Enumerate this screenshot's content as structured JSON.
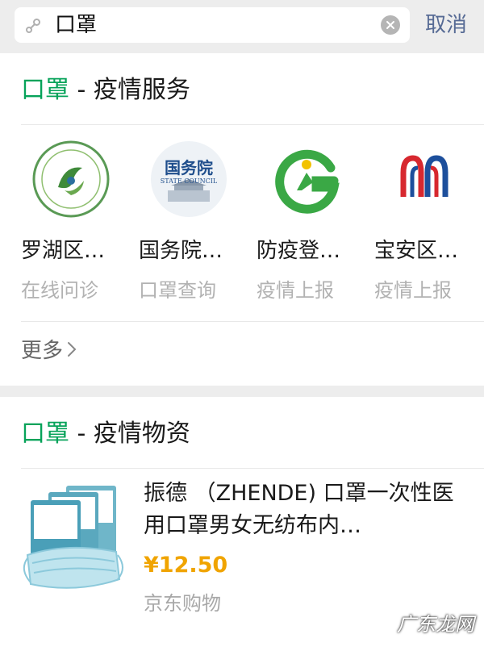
{
  "search": {
    "query": "口罩",
    "cancel_label": "取消"
  },
  "services_section": {
    "keyword": "口罩",
    "separator": " - ",
    "title": "疫情服务",
    "items": [
      {
        "name": "罗湖区…",
        "desc": "在线问诊",
        "logo": "luohu-health-logo"
      },
      {
        "name": "国务院…",
        "desc": "口罩查询",
        "logo": "state-council-logo",
        "logo_text": "国务院",
        "logo_subtext": "STATE COUNCIL"
      },
      {
        "name": "防疫登…",
        "desc": "疫情上报",
        "logo": "epidemic-registration-logo"
      },
      {
        "name": "宝安区…",
        "desc": "疫情上报",
        "logo": "baoan-district-logo"
      }
    ],
    "more_label": "更多"
  },
  "supplies_section": {
    "keyword": "口罩",
    "separator": " - ",
    "title": "疫情物资",
    "product": {
      "title": "振德 （ZHENDE) 口罩一次性医用口罩男女无纺布内…",
      "price": "¥12.50",
      "store": "京东购物"
    }
  },
  "watermark": "广东龙网",
  "colors": {
    "keyword_green": "#07a35a",
    "price_orange": "#f0a400",
    "cancel_blue": "#576b95"
  }
}
